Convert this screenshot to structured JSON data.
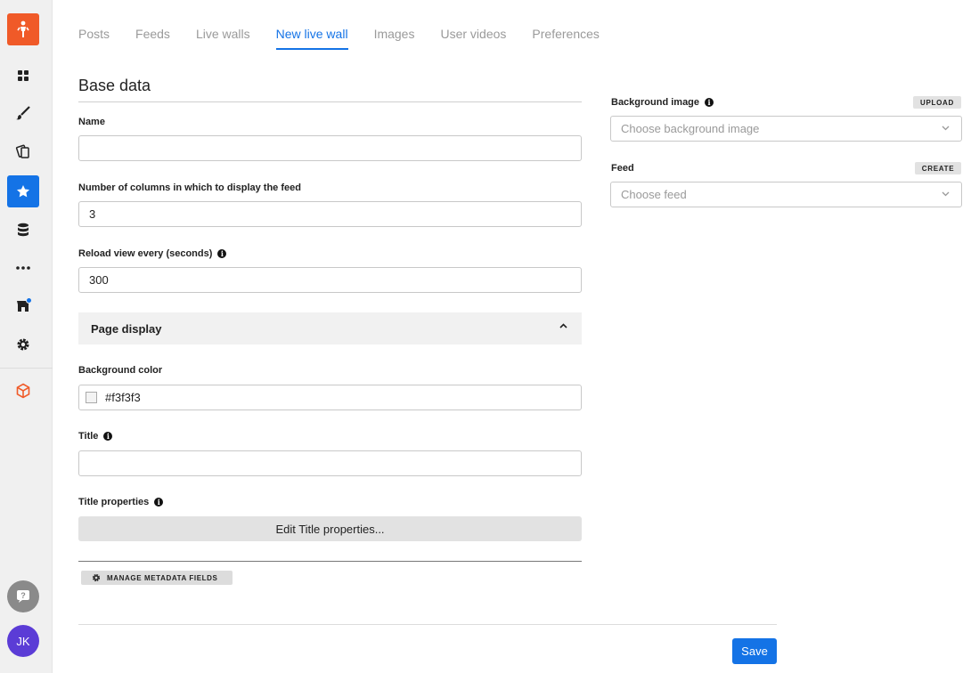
{
  "sidebar": {
    "items": [
      "logo-icon",
      "grid-icon",
      "brush-icon",
      "pages-icon",
      "star-icon",
      "database-icon",
      "more-icon",
      "store-icon",
      "gear-icon",
      "cube-icon"
    ],
    "accent": "#f05a28",
    "active": "#1473e6",
    "avatar_initials": "JK"
  },
  "tabs": [
    {
      "label": "Posts"
    },
    {
      "label": "Feeds"
    },
    {
      "label": "Live walls"
    },
    {
      "label": "New live wall"
    },
    {
      "label": "Images"
    },
    {
      "label": "User videos"
    },
    {
      "label": "Preferences"
    }
  ],
  "active_tab": "New live wall",
  "form": {
    "section_title": "Base data",
    "name_label": "Name",
    "name_value": "",
    "columns_label": "Number of columns in which to display the feed",
    "columns_value": "3",
    "reload_label": "Reload view every (seconds)",
    "reload_value": "300",
    "page_display_title": "Page display",
    "bg_color_label": "Background color",
    "bg_color_value": "#f3f3f3",
    "title_label": "Title",
    "title_value": "",
    "title_props_label": "Title properties",
    "edit_title_button": "Edit Title properties...",
    "manage_metadata_button": "MANAGE METADATA FIELDS"
  },
  "right": {
    "bg_image_label": "Background image",
    "upload_button": "UPLOAD",
    "bg_image_placeholder": "Choose background image",
    "feed_label": "Feed",
    "create_button": "CREATE",
    "feed_placeholder": "Choose feed"
  },
  "footer": {
    "save_button": "Save"
  }
}
